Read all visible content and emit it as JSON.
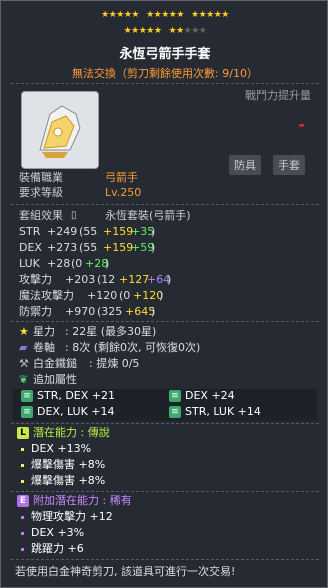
{
  "stars": {
    "row1": [
      "★★★★★",
      "★★★★★",
      "★★★★★"
    ],
    "row2_filled1": "★★★★★",
    "row2_filled2": "★★",
    "row2_empty": "★★★"
  },
  "item": {
    "name": "永恆弓箭手手套",
    "trade_note": "無法交換（剪刀剩餘使用次數: 9/10）",
    "power_label": "戰鬥力提升量",
    "power_value": "-",
    "tags": [
      "防具",
      "手套"
    ]
  },
  "requirements": {
    "job_label": "裝備職業",
    "job_value": "弓箭手",
    "level_label": "要求等級",
    "level_value": "Lv.250"
  },
  "set": {
    "label": "套組效果",
    "name": "永恆套裝(弓箭手)"
  },
  "stats": [
    {
      "name": "STR",
      "total": "+249",
      "base": "(55",
      "a": "+159",
      "b": "+35",
      "close": ")"
    },
    {
      "name": "DEX",
      "total": "+273",
      "base": "(55",
      "a": "+159",
      "b": "+59",
      "close": ")"
    },
    {
      "name": "LUK",
      "total": "+28",
      "base": "(0",
      "a": "",
      "b": "+28",
      "close": ")"
    },
    {
      "name": "攻擊力",
      "total": "+203",
      "base": "(12",
      "a": "+127",
      "b": "+64",
      "close": ")"
    },
    {
      "name": "魔法攻擊力",
      "total": "+120",
      "base": "(0",
      "a": "",
      "b": "+120",
      "close": ")"
    },
    {
      "name": "防禦力",
      "total": "+970",
      "base": "(325",
      "a": "+645",
      "b": "",
      "close": ")"
    }
  ],
  "upgrades": {
    "star_label": "星力",
    "star_value": ": 22星 (最多30星)",
    "scroll_label": "卷軸",
    "scroll_value": ": 8次 (剩餘0次, 可恢復0次)",
    "hammer_label": "白金鐵鎚",
    "hammer_value": ": 提煉 0/5"
  },
  "bonus": {
    "header": "追加屬性",
    "cells": [
      "STR, DEX +21",
      "DEX +24",
      "DEX, LUK +14",
      "STR, LUK +14"
    ]
  },
  "potential": {
    "label": "潛在能力 : 傳說",
    "lines": [
      "DEX +13%",
      "爆擊傷害 +8%",
      "爆擊傷害 +8%"
    ]
  },
  "additional": {
    "label": "附加潛在能力 : 稀有",
    "lines": [
      "物理攻擊力 +12",
      "DEX +3%",
      "跳躍力 +6"
    ]
  },
  "footer": "若使用白金神奇剪刀, 該道具可進行一次交易!",
  "colors": {
    "orange": "#ff9933",
    "yellow": "#ffdd33",
    "green": "#66ee66",
    "purple": "#aa88ff"
  }
}
